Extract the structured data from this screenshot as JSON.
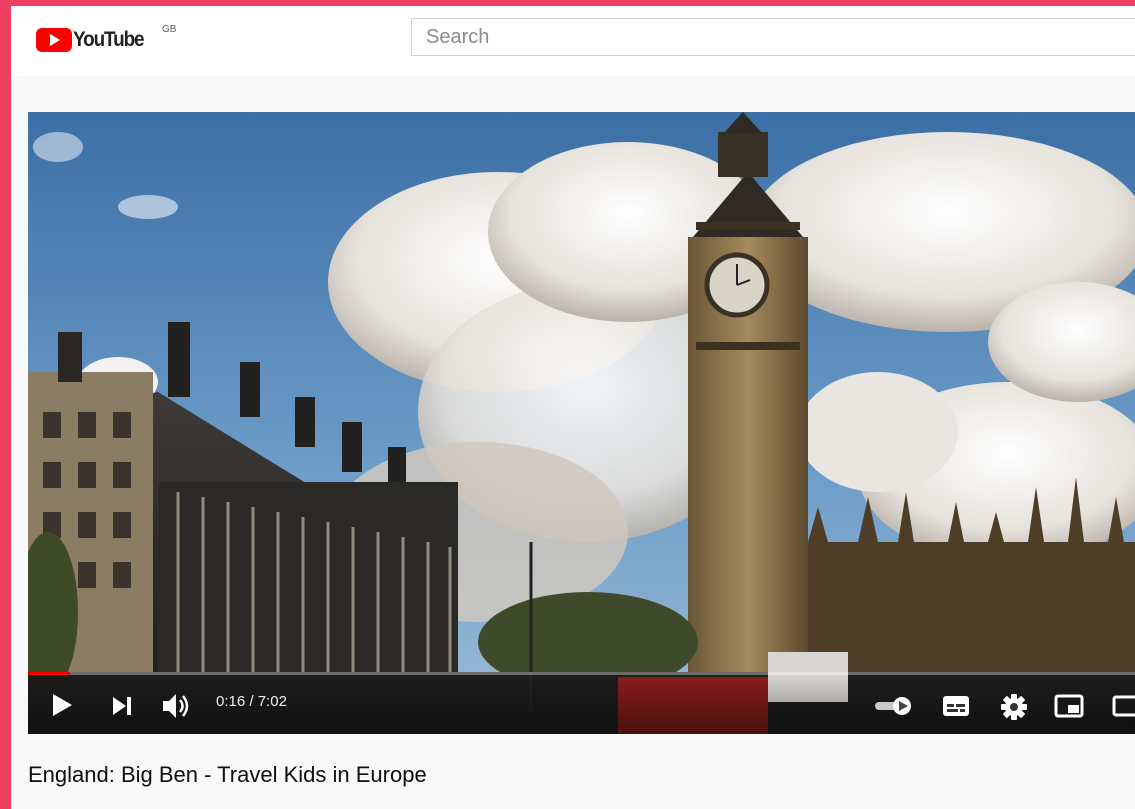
{
  "masthead": {
    "logo_text": "YouTube",
    "country_code": "GB",
    "search_placeholder": "Search"
  },
  "player": {
    "current_time": "0:16",
    "separator": " / ",
    "duration": "7:02",
    "progress_fraction": 0.038,
    "controls": [
      "play-icon",
      "next-icon",
      "volume-icon",
      "autoplay-toggle-icon",
      "subtitles-icon",
      "settings-icon",
      "miniplayer-icon",
      "theater-mode-icon"
    ]
  },
  "video": {
    "title": "England: Big Ben - Travel Kids in Europe"
  },
  "colors": {
    "accent_frame": "#f03e63",
    "youtube_red": "#ff0000"
  }
}
